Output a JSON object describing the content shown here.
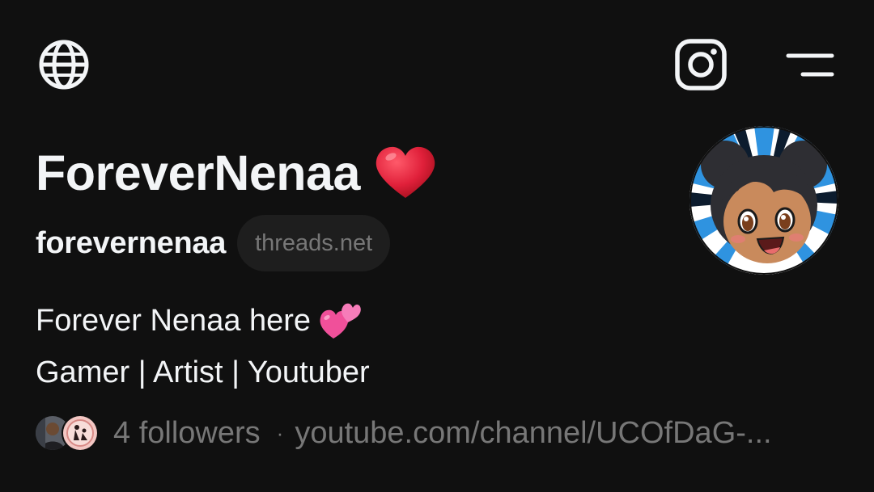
{
  "header": {
    "left_icon": "globe-icon",
    "right_icons": [
      "instagram-icon",
      "menu-icon"
    ]
  },
  "profile": {
    "display_name": "ForeverNenaa",
    "display_name_emoji": "red-heart-emoji",
    "username": "forevernenaa",
    "domain_badge": "threads.net",
    "avatar": "cartoon-avatar",
    "bio": {
      "line1": "Forever Nenaa here",
      "line1_emoji": "two-hearts-emoji",
      "line2": "Gamer | Artist | Youtuber"
    },
    "followers_label": "4 followers",
    "separator": "·",
    "link": "youtube.com/channel/UCOfDaG-..."
  },
  "colors": {
    "background": "#101010",
    "primary_text": "#f3f5f7",
    "secondary_text": "#777777",
    "pill_bg": "#1e1e1e",
    "heart": "#e0203a",
    "avatar_accent": "#3aa0e8"
  }
}
